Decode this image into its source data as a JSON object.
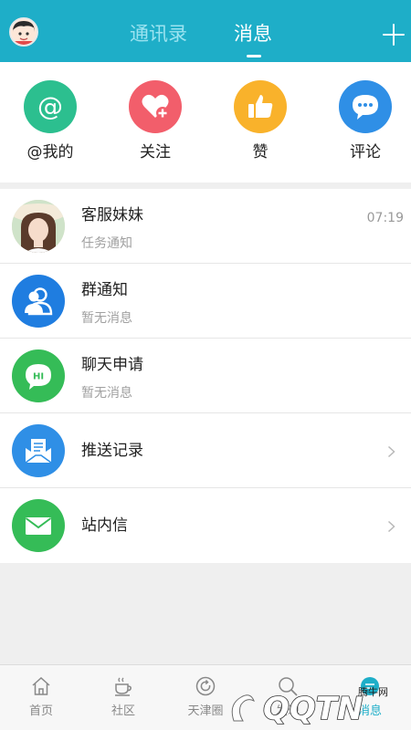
{
  "header": {
    "tabs": [
      {
        "label": "通讯录",
        "active": false
      },
      {
        "label": "消息",
        "active": true
      }
    ]
  },
  "quick_actions": [
    {
      "label": "@我的",
      "icon": "at-icon",
      "color": "#2cbf8f"
    },
    {
      "label": "关注",
      "icon": "heart-plus-icon",
      "color": "#f25e6b"
    },
    {
      "label": "赞",
      "icon": "thumbs-up-icon",
      "color": "#f9b22b"
    },
    {
      "label": "评论",
      "icon": "chat-bubble-icon",
      "color": "#2f8fe6"
    }
  ],
  "messages": [
    {
      "title": "客服妹妹",
      "subtitle": "任务通知",
      "time": "07:19",
      "icon": "avatar-photo"
    },
    {
      "title": "群通知",
      "subtitle": "暂无消息",
      "icon": "group-icon",
      "color": "#1f7de0"
    },
    {
      "title": "聊天申请",
      "subtitle": "暂无消息",
      "icon": "hi-chat-icon",
      "color": "#35bc57"
    },
    {
      "title": "推送记录",
      "icon": "push-record-icon",
      "color": "#2f8fe6"
    },
    {
      "title": "站内信",
      "icon": "envelope-icon",
      "color": "#35bc57"
    }
  ],
  "bottom_nav": [
    {
      "label": "首页",
      "icon": "home-icon",
      "active": false
    },
    {
      "label": "社区",
      "icon": "coffee-cup-icon",
      "active": false
    },
    {
      "label": "天津圈",
      "icon": "refresh-circle-icon",
      "active": false
    },
    {
      "label": "发现",
      "icon": "search-icon",
      "active": false
    },
    {
      "label": "消息",
      "icon": "message-icon",
      "active": true
    }
  ],
  "watermark": {
    "text": "QQTN",
    "subtext": "腾牛网"
  },
  "colors": {
    "header": "#1eaec8",
    "accent": "#1eaec8"
  }
}
